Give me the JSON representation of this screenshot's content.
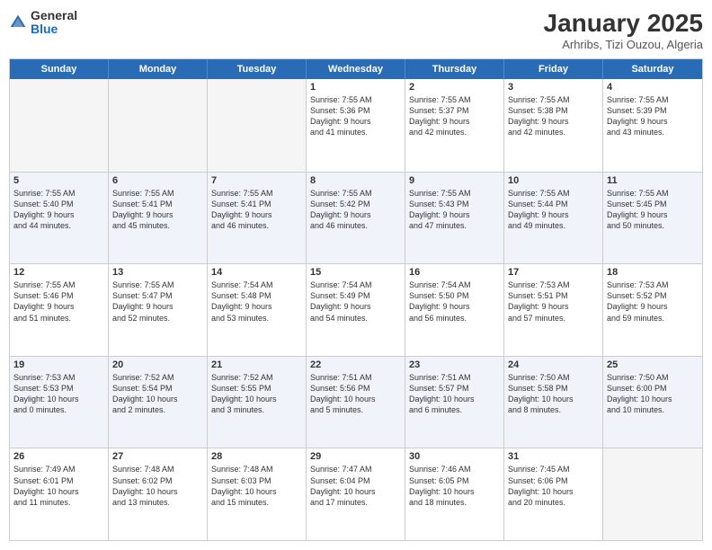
{
  "header": {
    "logo_general": "General",
    "logo_blue": "Blue",
    "month_title": "January 2025",
    "subtitle": "Arhribs, Tizi Ouzou, Algeria"
  },
  "weekdays": [
    "Sunday",
    "Monday",
    "Tuesday",
    "Wednesday",
    "Thursday",
    "Friday",
    "Saturday"
  ],
  "rows": [
    {
      "alt": false,
      "cells": [
        {
          "day": "",
          "lines": []
        },
        {
          "day": "",
          "lines": []
        },
        {
          "day": "",
          "lines": []
        },
        {
          "day": "1",
          "lines": [
            "Sunrise: 7:55 AM",
            "Sunset: 5:36 PM",
            "Daylight: 9 hours",
            "and 41 minutes."
          ]
        },
        {
          "day": "2",
          "lines": [
            "Sunrise: 7:55 AM",
            "Sunset: 5:37 PM",
            "Daylight: 9 hours",
            "and 42 minutes."
          ]
        },
        {
          "day": "3",
          "lines": [
            "Sunrise: 7:55 AM",
            "Sunset: 5:38 PM",
            "Daylight: 9 hours",
            "and 42 minutes."
          ]
        },
        {
          "day": "4",
          "lines": [
            "Sunrise: 7:55 AM",
            "Sunset: 5:39 PM",
            "Daylight: 9 hours",
            "and 43 minutes."
          ]
        }
      ]
    },
    {
      "alt": true,
      "cells": [
        {
          "day": "5",
          "lines": [
            "Sunrise: 7:55 AM",
            "Sunset: 5:40 PM",
            "Daylight: 9 hours",
            "and 44 minutes."
          ]
        },
        {
          "day": "6",
          "lines": [
            "Sunrise: 7:55 AM",
            "Sunset: 5:41 PM",
            "Daylight: 9 hours",
            "and 45 minutes."
          ]
        },
        {
          "day": "7",
          "lines": [
            "Sunrise: 7:55 AM",
            "Sunset: 5:41 PM",
            "Daylight: 9 hours",
            "and 46 minutes."
          ]
        },
        {
          "day": "8",
          "lines": [
            "Sunrise: 7:55 AM",
            "Sunset: 5:42 PM",
            "Daylight: 9 hours",
            "and 46 minutes."
          ]
        },
        {
          "day": "9",
          "lines": [
            "Sunrise: 7:55 AM",
            "Sunset: 5:43 PM",
            "Daylight: 9 hours",
            "and 47 minutes."
          ]
        },
        {
          "day": "10",
          "lines": [
            "Sunrise: 7:55 AM",
            "Sunset: 5:44 PM",
            "Daylight: 9 hours",
            "and 49 minutes."
          ]
        },
        {
          "day": "11",
          "lines": [
            "Sunrise: 7:55 AM",
            "Sunset: 5:45 PM",
            "Daylight: 9 hours",
            "and 50 minutes."
          ]
        }
      ]
    },
    {
      "alt": false,
      "cells": [
        {
          "day": "12",
          "lines": [
            "Sunrise: 7:55 AM",
            "Sunset: 5:46 PM",
            "Daylight: 9 hours",
            "and 51 minutes."
          ]
        },
        {
          "day": "13",
          "lines": [
            "Sunrise: 7:55 AM",
            "Sunset: 5:47 PM",
            "Daylight: 9 hours",
            "and 52 minutes."
          ]
        },
        {
          "day": "14",
          "lines": [
            "Sunrise: 7:54 AM",
            "Sunset: 5:48 PM",
            "Daylight: 9 hours",
            "and 53 minutes."
          ]
        },
        {
          "day": "15",
          "lines": [
            "Sunrise: 7:54 AM",
            "Sunset: 5:49 PM",
            "Daylight: 9 hours",
            "and 54 minutes."
          ]
        },
        {
          "day": "16",
          "lines": [
            "Sunrise: 7:54 AM",
            "Sunset: 5:50 PM",
            "Daylight: 9 hours",
            "and 56 minutes."
          ]
        },
        {
          "day": "17",
          "lines": [
            "Sunrise: 7:53 AM",
            "Sunset: 5:51 PM",
            "Daylight: 9 hours",
            "and 57 minutes."
          ]
        },
        {
          "day": "18",
          "lines": [
            "Sunrise: 7:53 AM",
            "Sunset: 5:52 PM",
            "Daylight: 9 hours",
            "and 59 minutes."
          ]
        }
      ]
    },
    {
      "alt": true,
      "cells": [
        {
          "day": "19",
          "lines": [
            "Sunrise: 7:53 AM",
            "Sunset: 5:53 PM",
            "Daylight: 10 hours",
            "and 0 minutes."
          ]
        },
        {
          "day": "20",
          "lines": [
            "Sunrise: 7:52 AM",
            "Sunset: 5:54 PM",
            "Daylight: 10 hours",
            "and 2 minutes."
          ]
        },
        {
          "day": "21",
          "lines": [
            "Sunrise: 7:52 AM",
            "Sunset: 5:55 PM",
            "Daylight: 10 hours",
            "and 3 minutes."
          ]
        },
        {
          "day": "22",
          "lines": [
            "Sunrise: 7:51 AM",
            "Sunset: 5:56 PM",
            "Daylight: 10 hours",
            "and 5 minutes."
          ]
        },
        {
          "day": "23",
          "lines": [
            "Sunrise: 7:51 AM",
            "Sunset: 5:57 PM",
            "Daylight: 10 hours",
            "and 6 minutes."
          ]
        },
        {
          "day": "24",
          "lines": [
            "Sunrise: 7:50 AM",
            "Sunset: 5:58 PM",
            "Daylight: 10 hours",
            "and 8 minutes."
          ]
        },
        {
          "day": "25",
          "lines": [
            "Sunrise: 7:50 AM",
            "Sunset: 6:00 PM",
            "Daylight: 10 hours",
            "and 10 minutes."
          ]
        }
      ]
    },
    {
      "alt": false,
      "cells": [
        {
          "day": "26",
          "lines": [
            "Sunrise: 7:49 AM",
            "Sunset: 6:01 PM",
            "Daylight: 10 hours",
            "and 11 minutes."
          ]
        },
        {
          "day": "27",
          "lines": [
            "Sunrise: 7:48 AM",
            "Sunset: 6:02 PM",
            "Daylight: 10 hours",
            "and 13 minutes."
          ]
        },
        {
          "day": "28",
          "lines": [
            "Sunrise: 7:48 AM",
            "Sunset: 6:03 PM",
            "Daylight: 10 hours",
            "and 15 minutes."
          ]
        },
        {
          "day": "29",
          "lines": [
            "Sunrise: 7:47 AM",
            "Sunset: 6:04 PM",
            "Daylight: 10 hours",
            "and 17 minutes."
          ]
        },
        {
          "day": "30",
          "lines": [
            "Sunrise: 7:46 AM",
            "Sunset: 6:05 PM",
            "Daylight: 10 hours",
            "and 18 minutes."
          ]
        },
        {
          "day": "31",
          "lines": [
            "Sunrise: 7:45 AM",
            "Sunset: 6:06 PM",
            "Daylight: 10 hours",
            "and 20 minutes."
          ]
        },
        {
          "day": "",
          "lines": []
        }
      ]
    }
  ]
}
